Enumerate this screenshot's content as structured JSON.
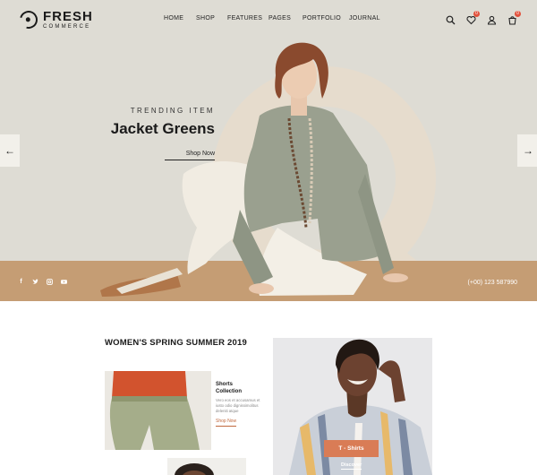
{
  "brand": {
    "name": "FRESH",
    "tagline": "COMMERCE"
  },
  "nav": [
    "HOME",
    "SHOP",
    "FEATURES",
    "PAGES",
    "PORTFOLIO",
    "JOURNAL"
  ],
  "header_icons": [
    {
      "icon": "search-icon"
    },
    {
      "icon": "wishlist-icon",
      "badge": "0"
    },
    {
      "icon": "user-icon"
    },
    {
      "icon": "cart-icon",
      "badge": "0"
    }
  ],
  "hero": {
    "eyebrow": "TRENDING ITEM",
    "title": "Jacket Greens",
    "cta": "Shop Now",
    "prev_icon": "arrow-left-icon",
    "next_icon": "arrow-right-icon",
    "phone": "(+00) 123 587990",
    "socials": [
      "facebook-icon",
      "twitter-icon",
      "instagram-icon",
      "youtube-icon"
    ]
  },
  "collection": {
    "title": "WOMEN'S SPRING SUMMER 2019",
    "card": {
      "title": "Shorts Collection",
      "text": "Vero eos et accusamus et iusto odio dignissimolitus deleniti atque",
      "link": "Shop Now"
    },
    "promo": {
      "button": "T - Shirts",
      "link": "Discover"
    }
  },
  "colors": {
    "hero_bg": "#dedcd4",
    "floor": "#c59d74",
    "accent": "#d97c56",
    "badge": "#e2513c"
  }
}
